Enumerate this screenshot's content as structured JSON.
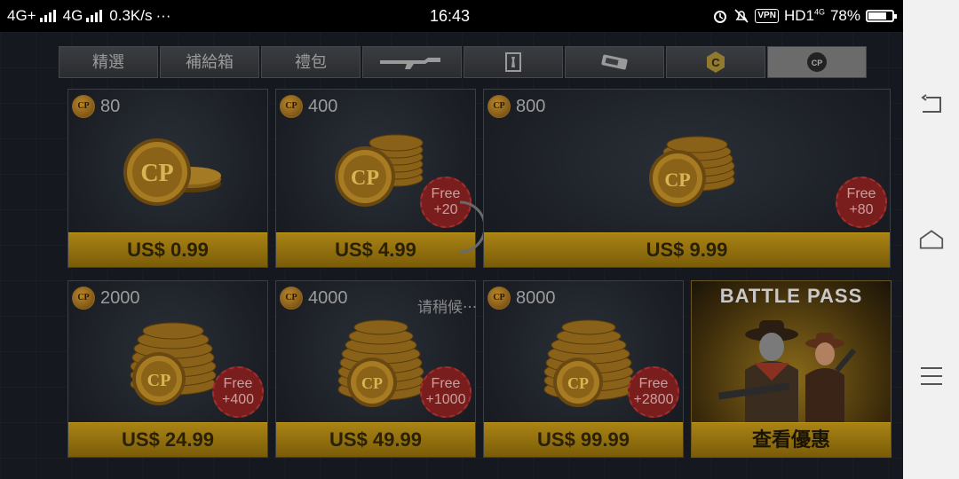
{
  "status_bar": {
    "network1": "4G+",
    "network2": "4G",
    "speed": "0.3K/s",
    "more": "···",
    "time": "16:43",
    "vpn": "VPN",
    "hd": "HD1",
    "net_small": "4G",
    "battery_text": "78%",
    "battery_level": 0.78
  },
  "tabs": [
    {
      "label": "精選",
      "icon": ""
    },
    {
      "label": "補給箱",
      "icon": ""
    },
    {
      "label": "禮包",
      "icon": ""
    },
    {
      "label": "",
      "icon": "rifle-icon"
    },
    {
      "label": "",
      "icon": "character-icon"
    },
    {
      "label": "",
      "icon": "ticket-icon"
    },
    {
      "label": "",
      "icon": "c-coin-icon"
    },
    {
      "label": "",
      "icon": "cp-coin-icon"
    }
  ],
  "active_tab": 7,
  "cp_badge": "CP",
  "offers": [
    {
      "amount": "80",
      "price": "US$ 0.99",
      "bonus": ""
    },
    {
      "amount": "400",
      "price": "US$ 4.99",
      "bonus": "Free +20"
    },
    {
      "amount": "800",
      "price": "US$ 9.99",
      "bonus": "Free +80"
    },
    {
      "amount": "2000",
      "price": "US$ 24.99",
      "bonus": "Free +400"
    },
    {
      "amount": "4000",
      "price": "US$ 49.99",
      "bonus": "Free +1000"
    },
    {
      "amount": "8000",
      "price": "US$ 99.99",
      "bonus": "Free +2800"
    }
  ],
  "battle_pass": {
    "title": "BATTLE PASS",
    "button": "查看優惠"
  },
  "loading_text": "请稍候···",
  "colors": {
    "gold": "#a98315",
    "free_badge": "#7a1d1d",
    "active_tab": "#6b6b6b"
  }
}
